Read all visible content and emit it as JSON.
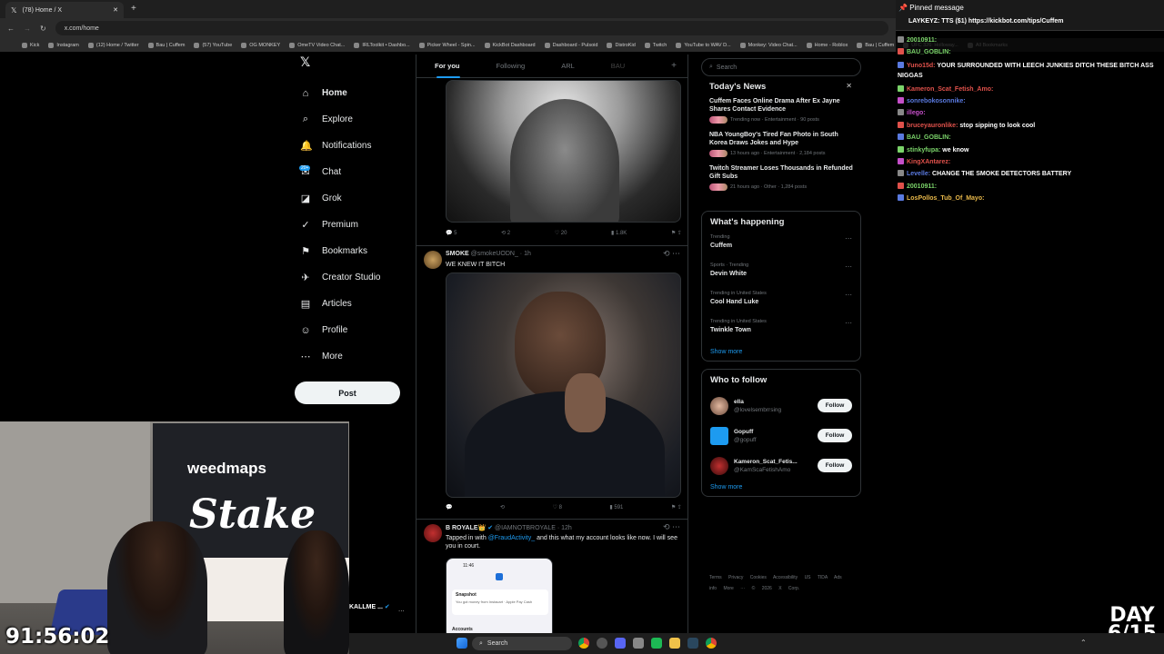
{
  "browser": {
    "tabs": [
      {
        "title": "(78) Home / X",
        "close": "✕"
      }
    ],
    "new_tab": "+",
    "url": "x.com/home",
    "bookmarks": [
      "Kick",
      "Instagram",
      "(12) Home / Twitter",
      "Bau | Cuffem",
      "(57) YouTube",
      "OG MONKEY",
      "OmeTV Video Chat...",
      "IRLToolkit • Dashbo...",
      "Picker Wheel - Spin...",
      "KickBot Dashboard",
      "Dashboard - Pulsoid",
      "DistroKid",
      "Twitch",
      "YouTube to WAV D...",
      "Monkey: Video Chat...",
      "Home - Roblox",
      "Bau | Cuffem",
      "UFC 326: Holloway...",
      "All Bookmarks"
    ]
  },
  "nav": {
    "logo": "𝕏",
    "items": [
      {
        "label": "Home",
        "icon": "⌂"
      },
      {
        "label": "Explore",
        "icon": "⌕"
      },
      {
        "label": "Notifications",
        "icon": "🔔"
      },
      {
        "label": "Chat",
        "icon": "✉"
      },
      {
        "label": "Grok",
        "icon": "◪"
      },
      {
        "label": "Premium",
        "icon": "✓"
      },
      {
        "label": "Bookmarks",
        "icon": "⚑"
      },
      {
        "label": "Creator Studio",
        "icon": "✈"
      },
      {
        "label": "Articles",
        "icon": "▤"
      },
      {
        "label": "Profile",
        "icon": "☺"
      },
      {
        "label": "More",
        "icon": "⋯"
      }
    ],
    "chat_badge": "20+",
    "post_label": "Post"
  },
  "feed": {
    "tabs": [
      "For you",
      "Following",
      "ARL",
      "BAU"
    ],
    "add_tab": "+",
    "tweet1": {
      "replies": "5",
      "reposts": "2",
      "likes": "20",
      "views": "1.8K"
    },
    "tweet2": {
      "name": "SMOKE",
      "handle": "@smokeUODN_ · 1h",
      "text": "WE KNEW IT BITCH",
      "replies": "",
      "reposts": "",
      "likes": "8",
      "views": "591"
    },
    "tweet3": {
      "name": "B ROYALE👑",
      "handle": "@IAMNOTBROYALE · 12h",
      "text_pre": "Tapped in with ",
      "mention": "@FraudActivity_",
      "text_post": " and this what my account looks like now. I will see you in court.",
      "phone_time": "11:46",
      "phone_item": "Snapshot",
      "phone_sub": "You got money from Instacart · Apple Pay Cash",
      "phone_accounts": "Accounts"
    },
    "bottom_name": "KALLME ...",
    "bottom_more": "..."
  },
  "right": {
    "search_placeholder": "Search",
    "news": {
      "title": "Today's News",
      "close": "✕",
      "items": [
        {
          "title": "Cuffem Faces Online Drama After Ex Jayne Shares Contact Evidence",
          "meta": "Trending now · Entertainment · 90 posts"
        },
        {
          "title": "NBA YoungBoy's Tired Fan Photo in South Korea Draws Jokes and Hype",
          "meta": "13 hours ago · Entertainment · 2,184 posts"
        },
        {
          "title": "Twitch Streamer Loses Thousands in Refunded Gift Subs",
          "meta": "21 hours ago · Other · 1,284 posts"
        }
      ]
    },
    "happening": {
      "title": "What's happening",
      "items": [
        {
          "context": "Trending",
          "name": "Cuffem"
        },
        {
          "context": "Sports · Trending",
          "name": "Devin White"
        },
        {
          "context": "Trending in United States",
          "name": "Cool Hand Luke"
        },
        {
          "context": "Trending in United States",
          "name": "Twinkle Town"
        }
      ],
      "show_more": "Show more"
    },
    "who_to_follow": {
      "title": "Who to follow",
      "items": [
        {
          "name": "ella",
          "handle": "@lovelsembrrsing"
        },
        {
          "name": "Gopuff",
          "handle": "@gopuff"
        },
        {
          "name": "Kameron_Scat_Fetis...",
          "handle": "@KamScaFetishAmo"
        }
      ],
      "follow_label": "Follow",
      "show_more": "Show more"
    },
    "footer": "Terms Privacy Cookies Accessibility US TIDA Ads info More ··· © 2026 X Corp."
  },
  "chat": {
    "pinned_label": "Pinned message",
    "pinned_text": "LAYKEYZ: TTS ($1) https://kickbot.com/tips/Cuffem",
    "lines": [
      {
        "user": "20010911:",
        "msg": "",
        "color": "#7bd46a"
      },
      {
        "user": "BAU_GOBLIN:",
        "msg": "",
        "color": "#7bd46a"
      },
      {
        "user": "Yuno15d:",
        "msg": "YOUR SURROUNDED WITH LEECH JUNKIES DITCH THESE BITCH ASS NIGGAS",
        "color": "#e0514b"
      },
      {
        "user": "Kameron_Scat_Fetish_Amo:",
        "msg": "",
        "color": "#e0514b"
      },
      {
        "user": "sonrebokosonnike:",
        "msg": "",
        "color": "#5a7ae0"
      },
      {
        "user": "illego:",
        "msg": "",
        "color": "#c54fc9"
      },
      {
        "user": "bruceyauronlike:",
        "msg": "stop sipping to look cool",
        "color": "#e0514b"
      },
      {
        "user": "BAU_GOBLIN:",
        "msg": "",
        "color": "#7bd46a"
      },
      {
        "user": "stinkyfupa:",
        "msg": "we know",
        "color": "#7bd46a"
      },
      {
        "user": "KingXAntarez:",
        "msg": "",
        "color": "#e0514b"
      },
      {
        "user": "Levelle:",
        "msg": "CHANGE THE SMOKE DETECTORS BATTERY",
        "color": "#5a7ae0"
      },
      {
        "user": "20010911:",
        "msg": "",
        "color": "#7bd46a"
      },
      {
        "user": "LosPollos_Tub_Of_Mayo:",
        "msg": "",
        "color": "#e8b84a"
      }
    ]
  },
  "overlay": {
    "timer": "91:56:02",
    "day_label": "DAY",
    "day_value": "6/15",
    "banner_weedmaps": "weedmaps",
    "banner_stake": "Stake"
  },
  "taskbar": {
    "search_placeholder": "Search"
  }
}
